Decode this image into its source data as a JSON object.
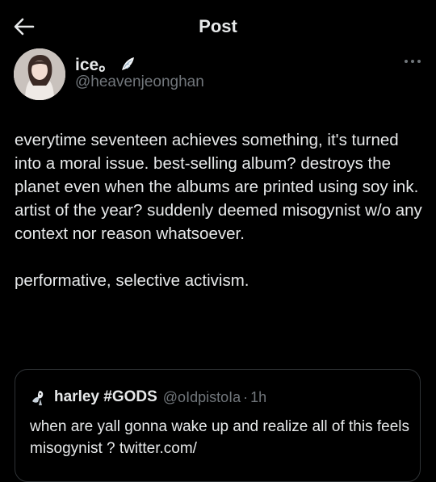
{
  "header": {
    "title": "Post",
    "back_icon": "arrow-left-icon"
  },
  "author": {
    "display_name": "ice。",
    "emoji_icon": "wing-icon",
    "handle": "@heavenjeonghan"
  },
  "tweet": {
    "paragraphs": [
      "everytime seventeen achieves something, it's turned into a moral issue. best-selling album? destroys the planet even when the albums are printed using soy ink. artist of the year? suddenly deemed misogynist w/o any context nor reason whatsoever.",
      "performative, selective activism."
    ]
  },
  "quote": {
    "display_name": "harley #GODS",
    "handle": "@oIdpistoIa",
    "separator": "·",
    "time": "1h",
    "text": "when are yall gonna wake up and realize all of this feels misogynist ? twitter.com/"
  },
  "colors": {
    "background": "#000000",
    "text": "#e7e9ea",
    "muted": "#71767b",
    "border": "#2f3336"
  }
}
